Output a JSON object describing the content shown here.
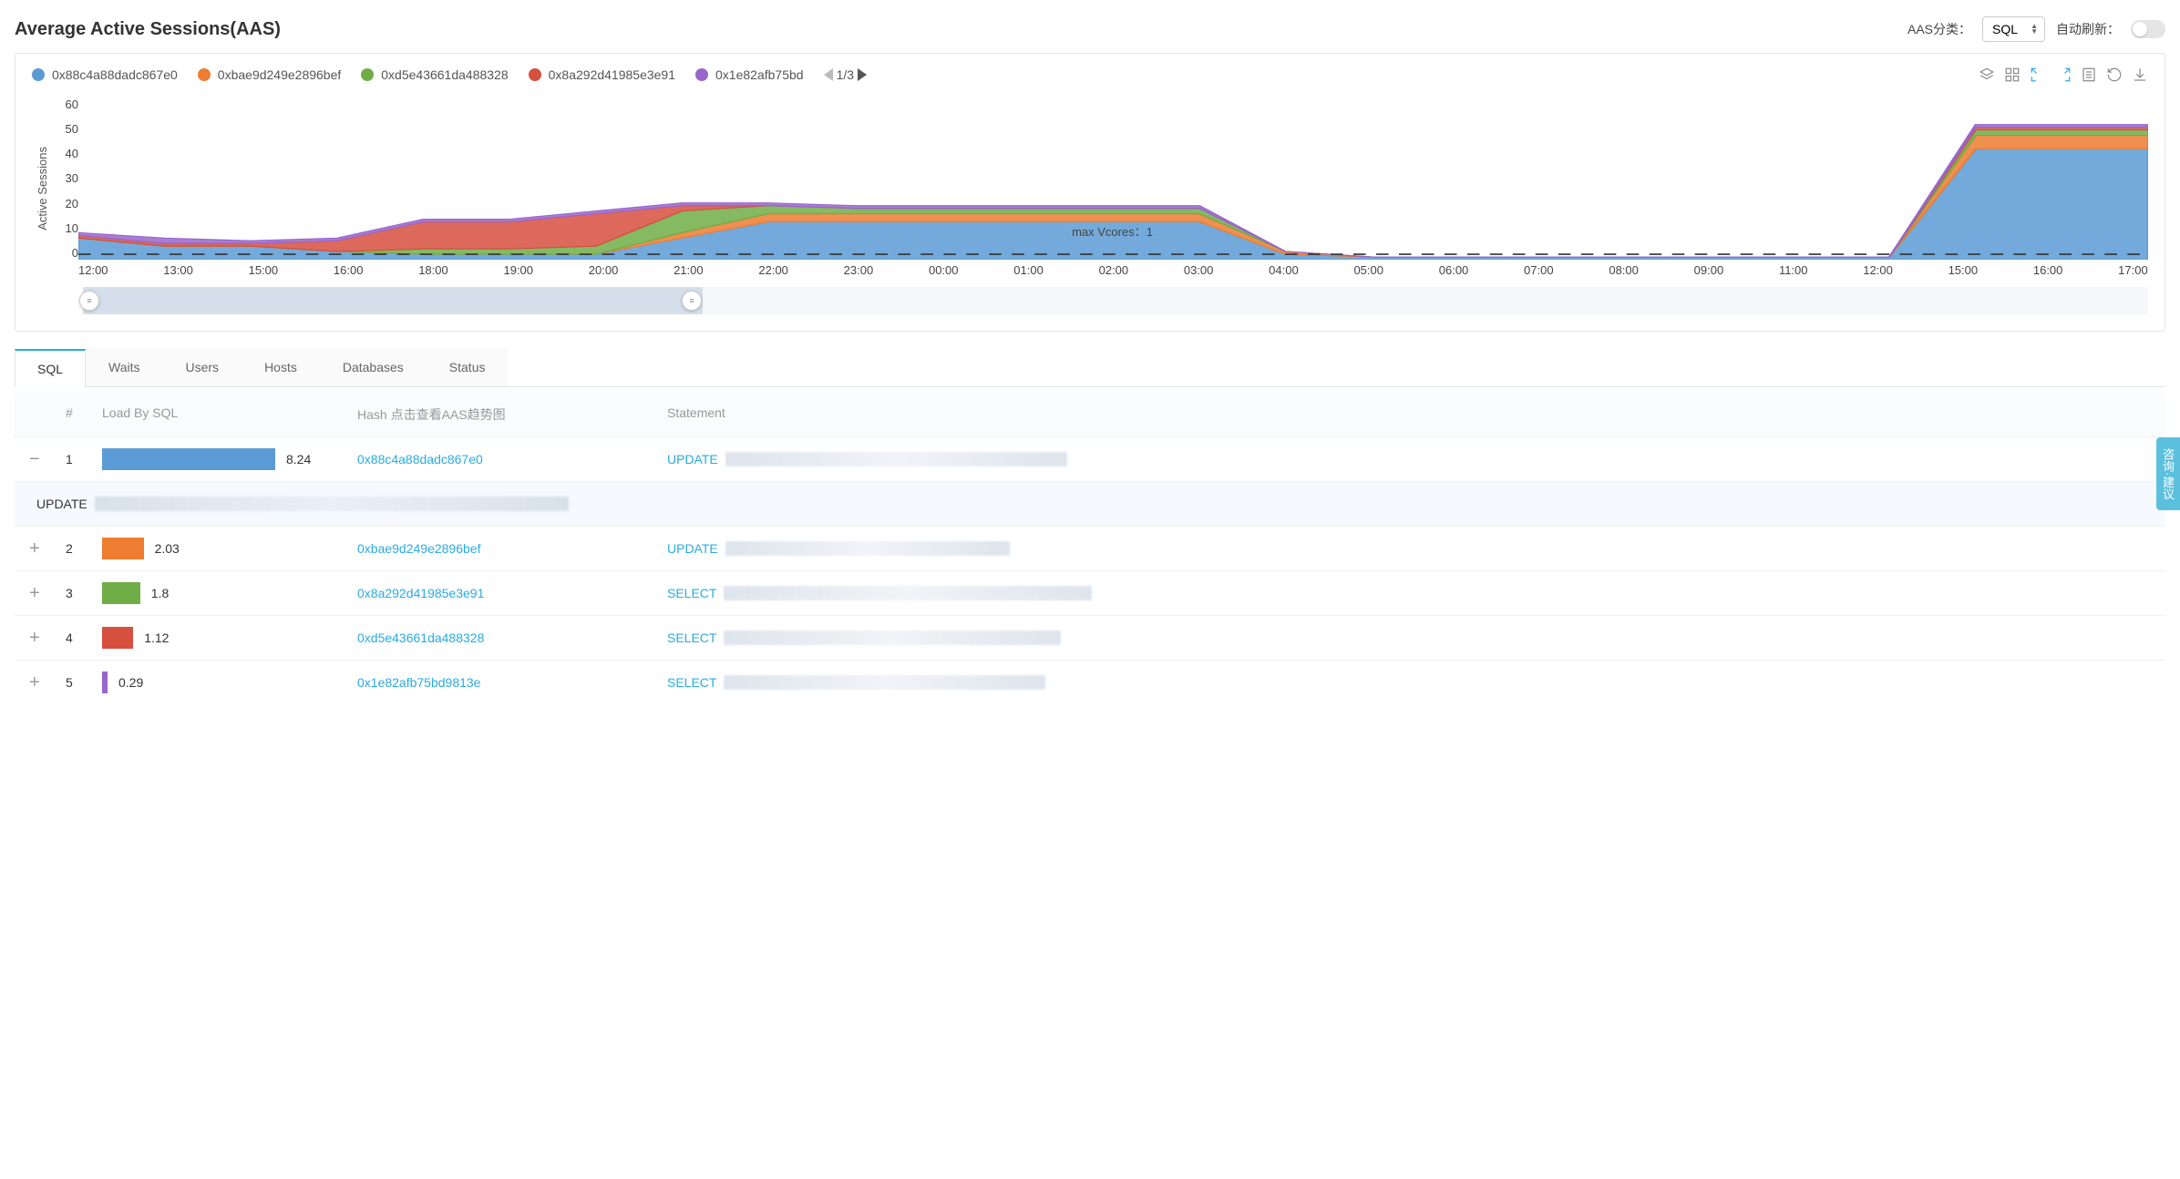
{
  "header": {
    "title": "Average Active Sessions(AAS)",
    "classify_label": "AAS分类：",
    "classify_value": "SQL",
    "refresh_label": "自动刷新："
  },
  "legend": {
    "items": [
      {
        "color": "#5b9bd5",
        "label": "0x88c4a88dadc867e0"
      },
      {
        "color": "#ed7d31",
        "label": "0xbae9d249e2896bef"
      },
      {
        "color": "#70ad47",
        "label": "0xd5e43661da488328"
      },
      {
        "color": "#d64f3f",
        "label": "0x8a292d41985e3e91"
      },
      {
        "color": "#9966cc",
        "label": "0x1e82afb75bd"
      }
    ],
    "pager": "1/3"
  },
  "chart_data": {
    "type": "area",
    "ylabel": "Active Sessions",
    "ylim": [
      0,
      60
    ],
    "yticks": [
      0,
      10,
      20,
      30,
      40,
      50,
      60
    ],
    "xticks": [
      "12:00",
      "13:00",
      "15:00",
      "16:00",
      "18:00",
      "19:00",
      "20:00",
      "21:00",
      "22:00",
      "23:00",
      "00:00",
      "01:00",
      "02:00",
      "03:00",
      "04:00",
      "05:00",
      "06:00",
      "07:00",
      "08:00",
      "09:00",
      "11:00",
      "12:00",
      "15:00",
      "16:00",
      "17:00"
    ],
    "annotation": "max Vcores：1",
    "series": [
      {
        "name": "0x88c4a88dadc867e0",
        "color": "#5b9bd5",
        "values": [
          8,
          5,
          5,
          3,
          2,
          2,
          2,
          8,
          14,
          14,
          14,
          14,
          14,
          14,
          2,
          1,
          1,
          1,
          1,
          1,
          1,
          1,
          41,
          41,
          41
        ]
      },
      {
        "name": "0xbae9d249e2896bef",
        "color": "#ed7d31",
        "values": [
          0,
          0,
          0,
          0,
          0,
          0,
          0,
          2,
          3,
          3,
          3,
          3,
          3,
          3,
          1,
          0,
          0,
          0,
          0,
          0,
          0,
          0,
          5,
          5,
          5
        ]
      },
      {
        "name": "0xd5e43661da488328",
        "color": "#70ad47",
        "values": [
          0,
          0,
          0,
          0,
          2,
          2,
          3,
          8,
          3,
          2,
          2,
          2,
          2,
          2,
          0,
          0,
          0,
          0,
          0,
          0,
          0,
          0,
          2,
          2,
          2
        ]
      },
      {
        "name": "0x8a292d41985e3e91",
        "color": "#d64f3f",
        "values": [
          1,
          1,
          1,
          4,
          10,
          10,
          12,
          2,
          0,
          0,
          0,
          0,
          0,
          0,
          0,
          0,
          0,
          0,
          0,
          0,
          0,
          0,
          1,
          1,
          1
        ]
      },
      {
        "name": "0x1e82afb75bd",
        "color": "#9966cc",
        "values": [
          1,
          2,
          1,
          1,
          1,
          1,
          1,
          1,
          1,
          1,
          1,
          1,
          1,
          1,
          0,
          0,
          0,
          0,
          0,
          0,
          0,
          0,
          1,
          1,
          1
        ]
      }
    ]
  },
  "tabs": [
    "SQL",
    "Waits",
    "Users",
    "Hosts",
    "Databases",
    "Status"
  ],
  "active_tab": "SQL",
  "table": {
    "headers": {
      "index": "#",
      "load": "Load By SQL",
      "hash": "Hash 点击查看AAS趋势图",
      "statement": "Statement"
    },
    "rows": [
      {
        "expanded": true,
        "index": 1,
        "load": 8.24,
        "bar_pct": 100,
        "color": "#5b9bd5",
        "hash": "0x88c4a88dadc867e0",
        "stmt_kw": "UPDATE",
        "detail_kw": "UPDATE"
      },
      {
        "expanded": false,
        "index": 2,
        "load": 2.03,
        "bar_pct": 24,
        "color": "#ed7d31",
        "hash": "0xbae9d249e2896bef",
        "stmt_kw": "UPDATE"
      },
      {
        "expanded": false,
        "index": 3,
        "load": 1.8,
        "bar_pct": 22,
        "color": "#70ad47",
        "hash": "0x8a292d41985e3e91",
        "stmt_kw": "SELECT"
      },
      {
        "expanded": false,
        "index": 4,
        "load": 1.12,
        "bar_pct": 18,
        "color": "#d64f3f",
        "hash": "0xd5e43661da488328",
        "stmt_kw": "SELECT"
      },
      {
        "expanded": false,
        "index": 5,
        "load": 0.29,
        "bar_pct": 3,
        "color": "#9966cc",
        "hash": "0x1e82afb75bd9813e",
        "stmt_kw": "SELECT"
      }
    ]
  },
  "feedback": "咨询·建议"
}
